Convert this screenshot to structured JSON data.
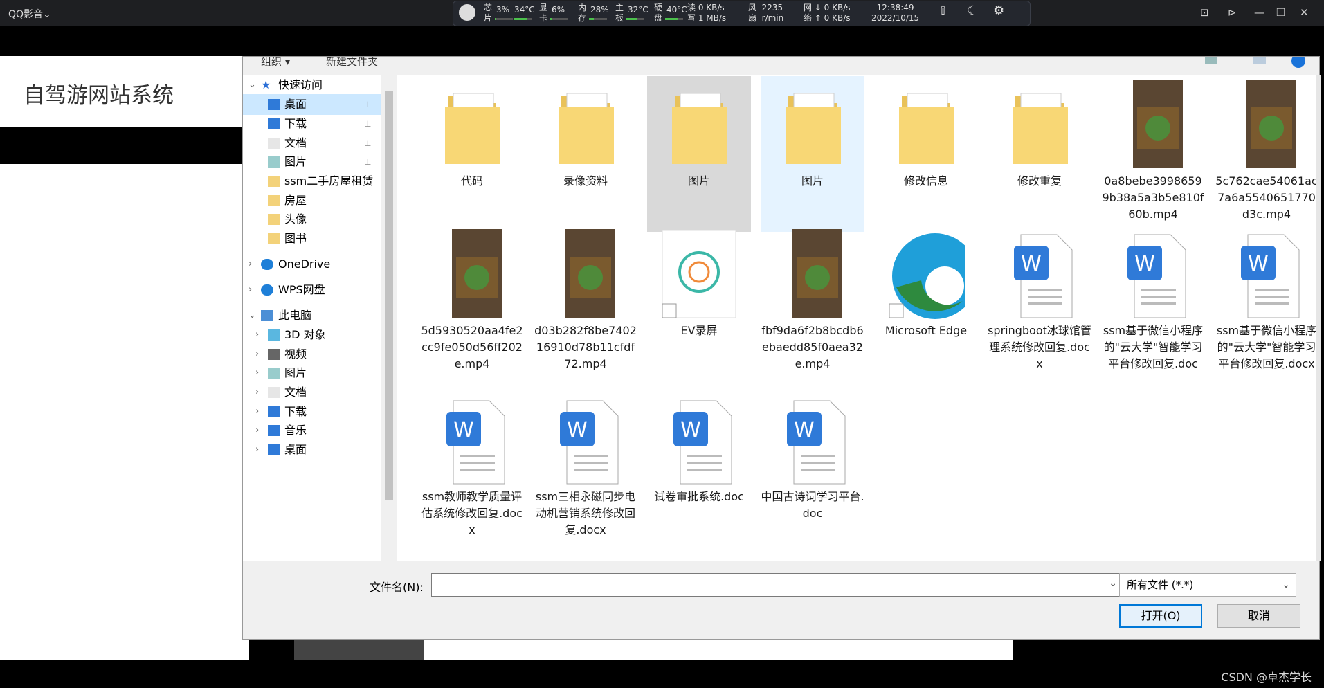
{
  "app": {
    "title": "QQ影音⌄"
  },
  "monitor": {
    "cpu_label": "芯\n片",
    "cpu_pct": "3%",
    "cpu_temp": "34°C",
    "gpu_label": "显\n卡",
    "gpu_pct": "6%",
    "mem_label": "内\n存",
    "mem_pct": "28%",
    "board_label": "主\n板",
    "board_temp": "32°C",
    "disk_label": "硬\n盘",
    "disk_temp": "40°C",
    "disk_io": "读 0 KB/s\n写 1 MB/s",
    "fan": "风  2235\n扇  r/min",
    "net": "网 ↓ 0 KB/s\n络 ↑ 0 KB/s",
    "clock": "12:38:49\n2022/10/15",
    "progress": {
      "cpu": 0.03,
      "gpu": 0.06,
      "mem": 0.28
    }
  },
  "page": {
    "site_title": "自驾游网站系统",
    "watermark": "CSDN @卓杰学长"
  },
  "dialog": {
    "toolbar": {
      "organize": "组织 ▾",
      "new_folder": "新建文件夹"
    },
    "nav": [
      {
        "label": "快速访问",
        "arrow": "⌄",
        "icon": "star-icon",
        "pin": ""
      },
      {
        "label": "桌面",
        "arrow": "",
        "icon": "desktop-icon",
        "pin": "📌"
      },
      {
        "label": "下载",
        "arrow": "",
        "icon": "download-icon",
        "pin": "📌"
      },
      {
        "label": "文档",
        "arrow": "",
        "icon": "document-icon",
        "pin": "📌"
      },
      {
        "label": "图片",
        "arrow": "",
        "icon": "picture-icon",
        "pin": "📌"
      },
      {
        "label": "ssm二手房屋租赁",
        "arrow": "",
        "icon": "folder-icon",
        "pin": ""
      },
      {
        "label": "房屋",
        "arrow": "",
        "icon": "folder-icon",
        "pin": ""
      },
      {
        "label": "头像",
        "arrow": "",
        "icon": "folder-icon",
        "pin": ""
      },
      {
        "label": "图书",
        "arrow": "",
        "icon": "folder-icon",
        "pin": ""
      },
      {
        "label": "OneDrive",
        "arrow": "›",
        "icon": "cloud-icon",
        "pin": ""
      },
      {
        "label": "WPS网盘",
        "arrow": "›",
        "icon": "cloud-icon",
        "pin": ""
      },
      {
        "label": "此电脑",
        "arrow": "⌄",
        "icon": "computer-icon",
        "pin": ""
      },
      {
        "label": "3D 对象",
        "arrow": "›",
        "icon": "cube-icon",
        "pin": ""
      },
      {
        "label": "视频",
        "arrow": "›",
        "icon": "video-icon",
        "pin": ""
      },
      {
        "label": "图片",
        "arrow": "›",
        "icon": "picture-icon",
        "pin": ""
      },
      {
        "label": "文档",
        "arrow": "›",
        "icon": "document-icon",
        "pin": ""
      },
      {
        "label": "下载",
        "arrow": "›",
        "icon": "download-icon",
        "pin": ""
      },
      {
        "label": "音乐",
        "arrow": "›",
        "icon": "music-icon",
        "pin": ""
      },
      {
        "label": "桌面",
        "arrow": "›",
        "icon": "desktop-icon",
        "pin": ""
      }
    ],
    "files": [
      {
        "name": "代码",
        "kind": "folder"
      },
      {
        "name": "录像资料",
        "kind": "folder"
      },
      {
        "name": "图片",
        "kind": "folder"
      },
      {
        "name": "图片",
        "kind": "folder"
      },
      {
        "name": "修改信息",
        "kind": "folder"
      },
      {
        "name": "修改重复",
        "kind": "folder"
      },
      {
        "name": "0a8bebe39986599b38a5a3b5e810f60b.mp4",
        "kind": "video"
      },
      {
        "name": "5c762cae54061ac7a6a5540651770d3c.mp4",
        "kind": "video"
      },
      {
        "name": "5d5930520aa4fe2cc9fe050d56ff202e.mp4",
        "kind": "video"
      },
      {
        "name": "d03b282f8be740216910d78b11cfdf72.mp4",
        "kind": "video"
      },
      {
        "name": "EV录屏",
        "kind": "shortcut-ev"
      },
      {
        "name": "fbf9da6f2b8bcdb6ebaedd85f0aea32e.mp4",
        "kind": "video"
      },
      {
        "name": "Microsoft Edge",
        "kind": "shortcut-edge"
      },
      {
        "name": "springboot冰球馆管理系统修改回复.docx",
        "kind": "word"
      },
      {
        "name": "ssm基于微信小程序的\"云大学\"智能学习平台修改回复.doc",
        "kind": "word"
      },
      {
        "name": "ssm基于微信小程序的\"云大学\"智能学习平台修改回复.docx",
        "kind": "word"
      },
      {
        "name": "ssm教师教学质量评估系统修改回复.docx",
        "kind": "word"
      },
      {
        "name": "ssm三相永磁同步电动机营销系统修改回复.docx",
        "kind": "word"
      },
      {
        "name": "试卷审批系统.doc",
        "kind": "word"
      },
      {
        "name": "中国古诗词学习平台.doc",
        "kind": "word"
      }
    ],
    "filename_label": "文件名(N):",
    "filename_value": "",
    "filter": "所有文件 (*.*)",
    "open_button": "打开(O)",
    "cancel_button": "取消"
  }
}
